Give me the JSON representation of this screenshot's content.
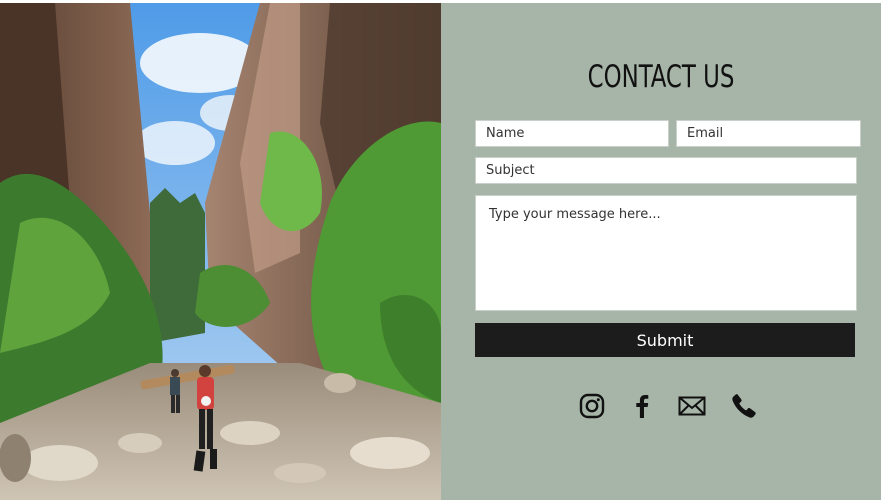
{
  "contact": {
    "title": "CONTACT US",
    "fields": {
      "name_placeholder": "Name",
      "email_placeholder": "Email",
      "subject_placeholder": "Subject",
      "message_placeholder": "Type your message here..."
    },
    "submit_label": "Submit"
  },
  "socials": [
    {
      "icon": "instagram-icon"
    },
    {
      "icon": "facebook-icon"
    },
    {
      "icon": "mail-icon"
    },
    {
      "icon": "phone-icon"
    }
  ],
  "colors": {
    "panel_background": "#a6b5a8",
    "button_background": "#1c1c1c",
    "button_text": "#ffffff",
    "title_text": "#111111"
  }
}
